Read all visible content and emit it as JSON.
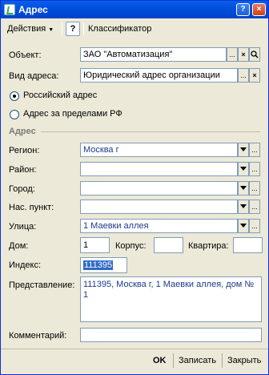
{
  "window": {
    "title": "Адрес"
  },
  "toolbar": {
    "actions_label": "Действия",
    "help_label": "?",
    "classifier_label": "Классификатор"
  },
  "form": {
    "object_label": "Объект:",
    "object_value": "ЗАО \"Автоматизация\"",
    "address_type_label": "Вид адреса:",
    "address_type_value": "Юридический адрес организации",
    "radio_russian": "Российский адрес",
    "radio_foreign": "Адрес за пределами РФ",
    "section_title": "Адрес",
    "region_label": "Регион:",
    "region_value": "Москва г",
    "district_label": "Район:",
    "district_value": "",
    "city_label": "Город:",
    "city_value": "",
    "settlement_label": "Нас. пункт:",
    "settlement_value": "",
    "street_label": "Улица:",
    "street_value": "1 Маевки аллея",
    "house_label": "Дом:",
    "house_value": "1",
    "building_label": "Корпус:",
    "building_value": "",
    "apartment_label": "Квартира:",
    "apartment_value": "",
    "index_label": "Индекс:",
    "index_value": "111395",
    "representation_label": "Представление:",
    "representation_value": "111395, Москва г, 1 Маевки аллея, дом № 1",
    "comment_label": "Комментарий:",
    "comment_value": ""
  },
  "footer": {
    "ok_label": "OK",
    "save_label": "Записать",
    "close_label": "Закрыть"
  },
  "icons": {
    "ellipsis": "...",
    "clear": "×",
    "search": "search-icon"
  }
}
